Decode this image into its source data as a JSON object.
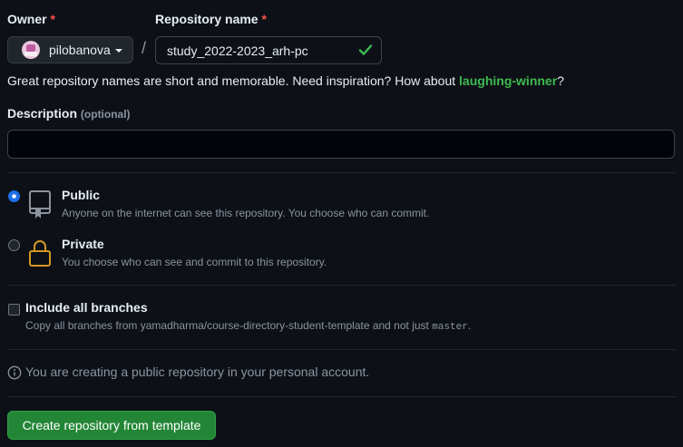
{
  "owner": {
    "label": "Owner",
    "required_mark": "*",
    "selected": "pilobanova"
  },
  "repository": {
    "label": "Repository name",
    "required_mark": "*",
    "separator": "/",
    "value": "study_2022-2023_arh-pc",
    "valid": true
  },
  "hint": {
    "text": "Great repository names are short and memorable. Need inspiration? How about ",
    "suggestion": "laughing-winner",
    "suffix": "?"
  },
  "description": {
    "label": "Description",
    "optional": "(optional)",
    "value": ""
  },
  "visibility": {
    "selected": "public",
    "options": [
      {
        "id": "public",
        "title": "Public",
        "description": "Anyone on the internet can see this repository. You choose who can commit."
      },
      {
        "id": "private",
        "title": "Private",
        "description": "You choose who can see and commit to this repository."
      }
    ]
  },
  "branches": {
    "label": "Include all branches",
    "checked": false,
    "description_prefix": "Copy all branches from yamadharma/course-directory-student-template and not just ",
    "branch_name": "master",
    "description_suffix": "."
  },
  "info": {
    "text": "You are creating a public repository in your personal account."
  },
  "submit": {
    "label": "Create repository from template"
  },
  "colors": {
    "accent_green": "#238636",
    "link_green": "#3fb950",
    "required_red": "#f85149",
    "radio_blue": "#1f6feb",
    "private_lock": "#d29922",
    "background": "#0d1117"
  }
}
